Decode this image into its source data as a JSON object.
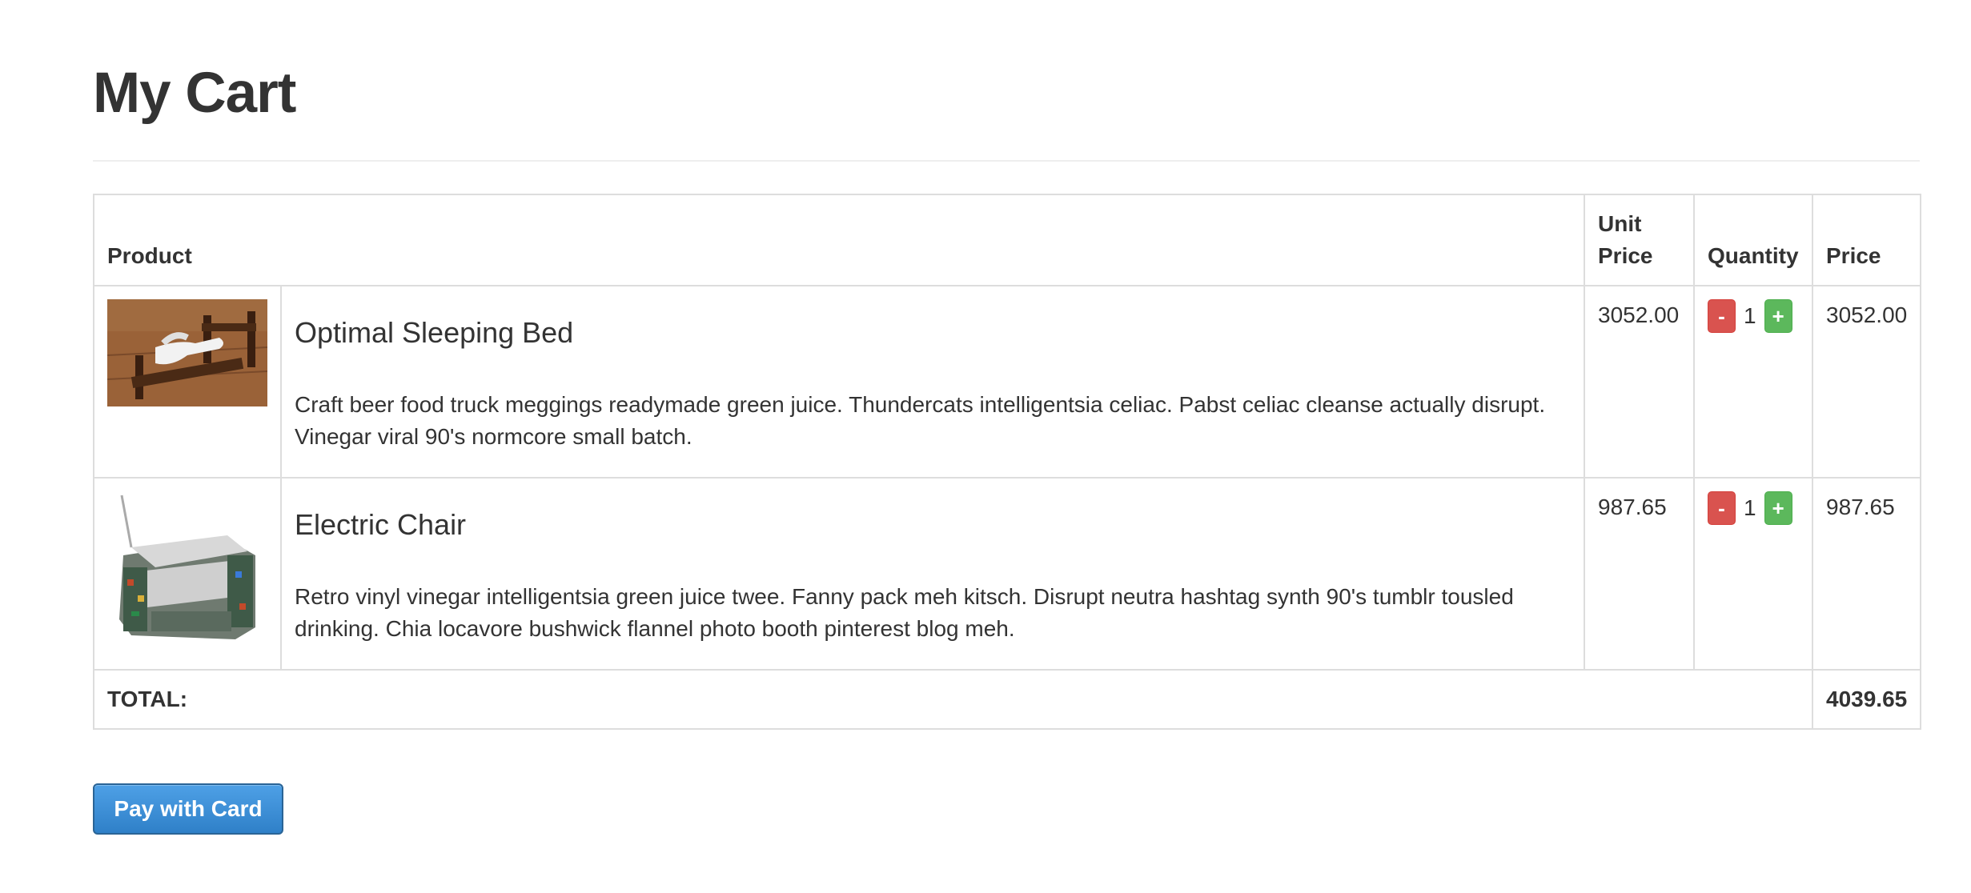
{
  "page": {
    "title": "My Cart"
  },
  "table": {
    "headers": {
      "product": "Product",
      "unit_price": "Unit Price",
      "quantity": "Quantity",
      "price": "Price"
    },
    "items": [
      {
        "name": "Optimal Sleeping Bed",
        "description": "Craft beer food truck meggings readymade green juice. Thundercats intelligentsia celiac. Pabst celiac cleanse actually disrupt. Vinegar viral 90's normcore small batch.",
        "unit_price": "3052.00",
        "quantity": "1",
        "price": "3052.00",
        "image_icon": "bed-photo"
      },
      {
        "name": "Electric Chair",
        "description": "Retro vinyl vinegar intelligentsia green juice twee. Fanny pack meh kitsch. Disrupt neutra hashtag synth 90's tumblr tousled drinking. Chia locavore bushwick flannel photo booth pinterest blog meh.",
        "unit_price": "987.65",
        "quantity": "1",
        "price": "987.65",
        "image_icon": "chair-photo"
      }
    ],
    "total_label": "TOTAL:",
    "total_value": "4039.65",
    "minus_label": "-",
    "plus_label": "+"
  },
  "actions": {
    "pay_label": "Pay with Card"
  },
  "colors": {
    "minus": "#d9534f",
    "plus": "#5cb85c",
    "pay": "#3a8ed6",
    "border": "#dddddd"
  }
}
